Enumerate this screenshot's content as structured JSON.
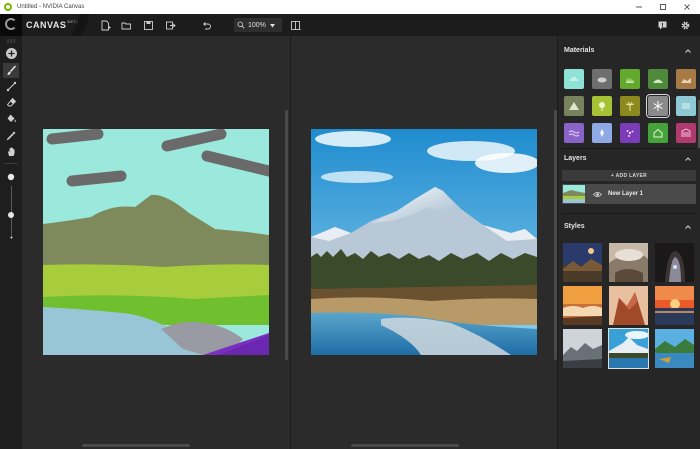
{
  "window": {
    "title": "Untitled - NVIDIA Canvas"
  },
  "brand": {
    "name": "CANVAS",
    "badge": "BETA"
  },
  "toolbar": {
    "zoom_label": "100%"
  },
  "panel": {
    "materials_title": "Materials",
    "layers_title": "Layers",
    "add_layer_label": "+ ADD LAYER",
    "layer_name": "New Layer 1",
    "styles_title": "Styles"
  },
  "materials": [
    {
      "name": "sky",
      "color": "#8fe3d6"
    },
    {
      "name": "cloud",
      "color": "#6f6f6f"
    },
    {
      "name": "grass",
      "color": "#62a92e"
    },
    {
      "name": "hill",
      "color": "#4f8a3c"
    },
    {
      "name": "dirt",
      "color": "#a67a45"
    },
    {
      "name": "mountain",
      "color": "#78825c"
    },
    {
      "name": "tree",
      "color": "#a8c236"
    },
    {
      "name": "palm",
      "color": "#8c8a1f"
    },
    {
      "name": "snow",
      "color": "#8a8a8a"
    },
    {
      "name": "fog",
      "color": "#8fc9d6"
    },
    {
      "name": "water",
      "color": "#8a63c9"
    },
    {
      "name": "ice",
      "color": "#8fa8e6"
    },
    {
      "name": "flowers",
      "color": "#7b3cb8"
    },
    {
      "name": "house",
      "color": "#46a23a"
    },
    {
      "name": "building",
      "color": "#b03a6e"
    }
  ],
  "colors": {
    "accent": "#76b900",
    "panel_bg": "#262626",
    "canvas_bg": "#2b2b2b"
  }
}
